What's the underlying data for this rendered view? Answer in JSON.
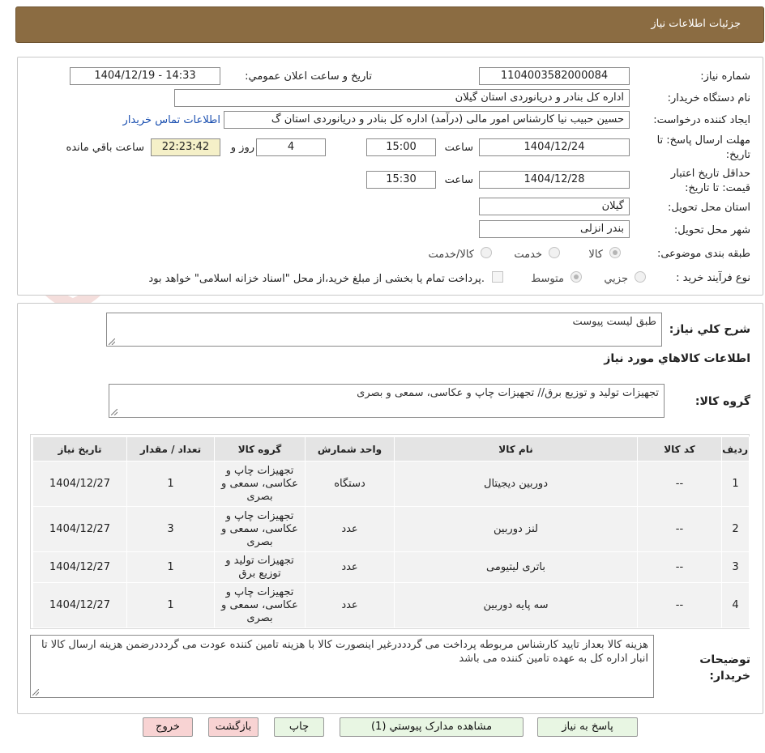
{
  "header": {
    "title": "جزئیات اطلاعات نیاز"
  },
  "watermark": {
    "text": "AriaTender.neT"
  },
  "form": {
    "need_number_label": "شماره نیاز:",
    "need_number": "1104003582000084",
    "announce_label": "تاریخ و ساعت اعلان عمومي:",
    "announce_value": "1404/12/19 - 14:33",
    "buyer_org_label": "نام دستگاه خریدار:",
    "buyer_org": "اداره کل بنادر و دریانوردی استان گیلان",
    "creator_label": "ایجاد کننده درخواست:",
    "creator": "حسین حبیب نیا کارشناس امور مالی (درآمد) اداره کل بنادر و دریانوردی استان گ",
    "contact_link": "اطلاعات تماس خریدار",
    "deadline_label": "مهلت ارسال پاسخ: تا تاریخ:",
    "deadline_date": "1404/12/24",
    "time_label": "ساعت",
    "deadline_time": "15:00",
    "days_value": "4",
    "days_label": "روز و",
    "remaining_time": "22:23:42",
    "remaining_label": "ساعت باقي مانده",
    "validity_label": "حداقل تاریخ اعتبار قیمت: تا تاریخ:",
    "validity_date": "1404/12/28",
    "validity_time": "15:30",
    "province_label": "استان محل تحویل:",
    "province": "گیلان",
    "city_label": "شهر محل تحویل:",
    "city": "بندر انزلی",
    "category_label": "طبقه بندی موضوعی:",
    "category_options": [
      "کالا",
      "خدمت",
      "کالا/خدمت"
    ],
    "purchase_type_label": "نوع فرآیند خرید :",
    "purchase_options": [
      "جزیي",
      "متوسط"
    ],
    "payment_note": "پرداخت تمام یا بخشی از مبلغ خرید،از محل \"اسناد خزانه اسلامی\" خواهد بود."
  },
  "details": {
    "summary_label": "شرح کلي نیاز:",
    "summary": "طبق لیست پیوست",
    "goods_info_title": "اطلاعات کالاهاي مورد نیاز",
    "goods_group_label": "گروه کالا:",
    "goods_group": "تجهیزات تولید و توزیع برق// تجهیزات چاپ و عکاسی، سمعی و بصری"
  },
  "table": {
    "headers": [
      "ردیف",
      "کد کالا",
      "نام کالا",
      "واحد شمارش",
      "گروه کالا",
      "تعداد / مقدار",
      "تاریخ نیاز"
    ],
    "rows": [
      {
        "row": "1",
        "code": "--",
        "name": "دوربین دیجیتال",
        "unit": "دستگاه",
        "group": "تجهیزات چاپ و عکاسی، سمعی و بصری",
        "qty": "1",
        "date": "1404/12/27"
      },
      {
        "row": "2",
        "code": "--",
        "name": "لنز دوربین",
        "unit": "عدد",
        "group": "تجهیزات چاپ و عکاسی، سمعی و بصری",
        "qty": "3",
        "date": "1404/12/27"
      },
      {
        "row": "3",
        "code": "--",
        "name": "باتری لیتیومی",
        "unit": "عدد",
        "group": "تجهیزات تولید و توزیع برق",
        "qty": "1",
        "date": "1404/12/27"
      },
      {
        "row": "4",
        "code": "--",
        "name": "سه پایه دوربین",
        "unit": "عدد",
        "group": "تجهیزات چاپ و عکاسی، سمعی و بصری",
        "qty": "1",
        "date": "1404/12/27"
      }
    ]
  },
  "buyer_notes": {
    "label": "توضیحات خریدار:",
    "text": "هزینه کالا بعداز تایید کارشناس مربوطه پرداخت می گردددرغیر اینصورت کالا با هزینه تامین کننده عودت می گردددرضمن هزینه ارسال کالا تا انبار اداره کل به عهده تامین کننده می باشد"
  },
  "buttons": {
    "reply": "پاسخ به نیاز",
    "attachments": "مشاهده مدارک پیوستي (1)",
    "print": "چاپ",
    "back": "بازگشت",
    "exit": "خروج"
  },
  "colors": {
    "header_bg": "#8b6c42",
    "link": "#1a4fb0",
    "green_button": "#e8f6e3",
    "pink_button": "#f8d3d3"
  }
}
